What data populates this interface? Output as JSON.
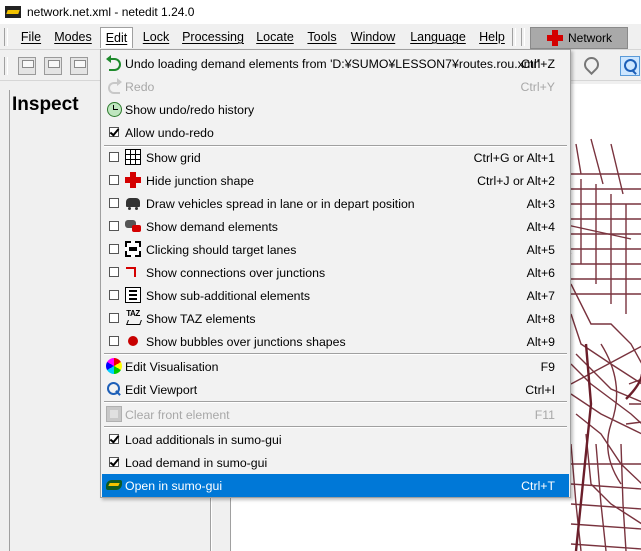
{
  "window": {
    "title": "network.net.xml - netedit 1.24.0"
  },
  "menubar": {
    "items": [
      {
        "label": "File"
      },
      {
        "label": "Modes"
      },
      {
        "label": "Edit",
        "active": true
      },
      {
        "label": "Lock"
      },
      {
        "label": "Processing"
      },
      {
        "label": "Locate"
      },
      {
        "label": "Tools"
      },
      {
        "label": "Window"
      },
      {
        "label": "Language"
      },
      {
        "label": "Help"
      }
    ],
    "network_button": {
      "label": "Network",
      "icon": "junction-icon"
    }
  },
  "inspect_panel": {
    "title": "Inspect"
  },
  "edit_menu": {
    "items": [
      {
        "label": "Undo loading demand elements from 'D:¥SUMO¥LESSON7¥routes.rou.xml'",
        "accel": "Ctrl+Z",
        "icon": "undo-icon",
        "enabled": true
      },
      {
        "label": "Redo",
        "accel": "Ctrl+Y",
        "icon": "redo-icon",
        "enabled": false
      },
      {
        "label": "Show undo/redo history",
        "accel": "",
        "icon": "history-icon",
        "enabled": true
      },
      {
        "label": "Allow undo-redo",
        "accel": "",
        "checkbox": true,
        "checked": true
      },
      {
        "label": "Show grid",
        "accel": "Ctrl+G or Alt+1",
        "checkbox": true,
        "checked": false,
        "icon": "grid-icon"
      },
      {
        "label": "Hide junction shape",
        "accel": "Ctrl+J or Alt+2",
        "checkbox": true,
        "checked": false,
        "icon": "junction-icon"
      },
      {
        "label": "Draw vehicles spread in lane or in depart position",
        "accel": "Alt+3",
        "checkbox": true,
        "checked": false,
        "icon": "vehicle-icon"
      },
      {
        "label": "Show demand elements",
        "accel": "Alt+4",
        "checkbox": true,
        "checked": false,
        "icon": "demand-icon"
      },
      {
        "label": "Clicking should target lanes",
        "accel": "Alt+5",
        "checkbox": true,
        "checked": false,
        "icon": "lanes-icon"
      },
      {
        "label": "Show connections over junctions",
        "accel": "Alt+6",
        "checkbox": true,
        "checked": false,
        "icon": "connections-icon"
      },
      {
        "label": "Show sub-additional elements",
        "accel": "Alt+7",
        "checkbox": true,
        "checked": false,
        "icon": "list-icon"
      },
      {
        "label": "Show TAZ elements",
        "accel": "Alt+8",
        "checkbox": true,
        "checked": false,
        "icon": "taz-icon",
        "icon_text": "TAZ"
      },
      {
        "label": "Show bubbles over junctions shapes",
        "accel": "Alt+9",
        "checkbox": true,
        "checked": false,
        "icon": "bubble-icon"
      },
      {
        "label": "Edit Visualisation",
        "accel": "F9",
        "icon": "palette-icon",
        "enabled": true
      },
      {
        "label": "Edit Viewport",
        "accel": "Ctrl+I",
        "icon": "viewport-icon",
        "enabled": true
      },
      {
        "label": "Clear front element",
        "accel": "F11",
        "icon": "clear-icon",
        "enabled": false
      },
      {
        "label": "Load additionals in sumo-gui",
        "accel": "",
        "checkbox": true,
        "checked": true
      },
      {
        "label": "Load demand in sumo-gui",
        "accel": "",
        "checkbox": true,
        "checked": true
      },
      {
        "label": "Open in sumo-gui",
        "accel": "Ctrl+T",
        "icon": "sumo-icon",
        "enabled": true,
        "highlighted": true
      }
    ]
  },
  "colors": {
    "highlight": "#0078d7",
    "junction_red": "#d40000",
    "road_network": "#6b1e2a",
    "network_button_bg": "#a9a9a9"
  }
}
